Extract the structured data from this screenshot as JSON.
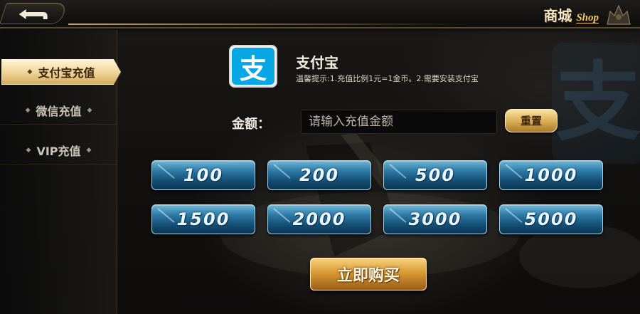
{
  "header": {
    "title_cn": "商城",
    "title_en": "Shop",
    "back_icon": "back-arrow-icon",
    "emblem_icon": "emblem-icon"
  },
  "sidebar": {
    "items": [
      {
        "label": "支付宝充值",
        "active": true
      },
      {
        "label": "微信充值",
        "active": false
      },
      {
        "label": "VIP充值",
        "active": false
      }
    ]
  },
  "payment": {
    "logo_glyph": "支",
    "title": "支付宝",
    "tip": "温馨提示:1.充值比例1元=1金币。2.需要安装支付宝",
    "watermark_glyph": "支"
  },
  "amount": {
    "label": "金额：",
    "placeholder": "请输入充值金额",
    "value": "",
    "reset_label": "重置"
  },
  "preset_amounts": [
    "100",
    "200",
    "500",
    "1000",
    "1500",
    "2000",
    "3000",
    "5000"
  ],
  "buy_label": "立即购买",
  "colors": {
    "accent_gold": "#d6ad5c",
    "amount_button_blue": "#2d7aa6",
    "alipay_blue": "#07a7e6"
  }
}
